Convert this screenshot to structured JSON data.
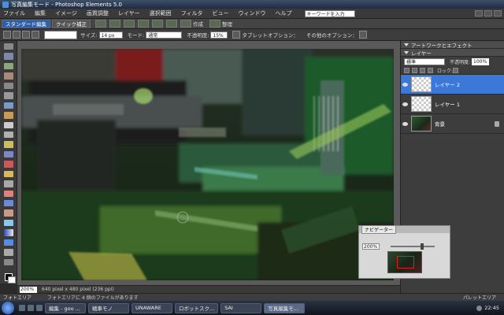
{
  "window": {
    "title": "写真編集モード - Photoshop Elements 5.0"
  },
  "menu": {
    "items": [
      "ファイル",
      "編集",
      "イメージ",
      "画質調整",
      "レイヤー",
      "選択範囲",
      "フィルタ",
      "ビュー",
      "ウィンドウ",
      "ヘルプ"
    ],
    "search_value": "キーワードを入力"
  },
  "toolbar": {
    "tab_standard": "スタンダード編集",
    "tab_quick": "クイック補正",
    "create_label": "作成",
    "organize_label": "整理"
  },
  "options": {
    "size_label": "サイズ:",
    "size_value": "14 px",
    "mode_label": "モード:",
    "mode_value": "通常",
    "opacity_label": "不透明度:",
    "opacity_value": "15%",
    "tablet_label": "タブレットオプション：",
    "other_label": "その他のオプション："
  },
  "panels": {
    "artwork_title": "アートワークとエフェクト",
    "layers_title": "レイヤー",
    "blend_mode": "標準",
    "opacity_label": "不透明度:",
    "opacity_value": "100%",
    "lock_label": "ロック:",
    "layers": [
      {
        "name": "レイヤー 2",
        "selected": true
      },
      {
        "name": "レイヤー 1",
        "selected": false
      },
      {
        "name": "背景",
        "selected": false
      }
    ]
  },
  "navigator": {
    "title": "ナビゲーター",
    "zoom": "200%"
  },
  "status": {
    "zoom": "200%",
    "info": "640 pixel x 480 pixel (236 ppi)"
  },
  "project_bin": {
    "label": "フォトエリア",
    "info": "フォトエリアに 4 個のファイルがあります",
    "right": "パレットエリア"
  },
  "taskbar": {
    "tasks": [
      "編集 - goo ...",
      "戦車モノ",
      "UNAWARE",
      "ロボットスク...",
      "SAI",
      "写真編集モ..."
    ],
    "active_index": 5,
    "clock": "22:45"
  }
}
